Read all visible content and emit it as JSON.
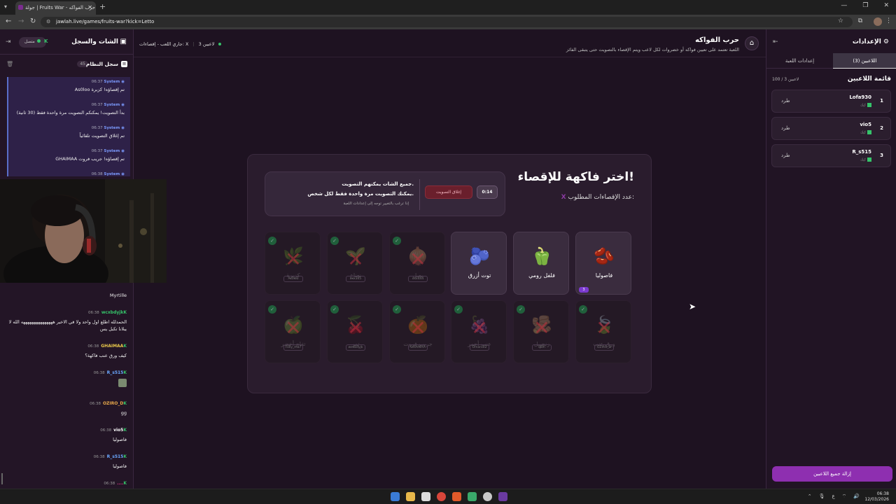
{
  "browser": {
    "tab_title": "جولة | Fruits War - حرب الفواكه",
    "url": "jawlah.live/games/fruits-war?kick=Letto"
  },
  "chat": {
    "title": "الشات والسجل",
    "status": "متصل",
    "syslog_label": "سجل النظام",
    "syslog_count": "45",
    "system_messages": [
      {
        "time": "06:37",
        "sender": "System",
        "text": "As0loo تم إقصاؤه! كزبرة"
      },
      {
        "time": "06:37",
        "sender": "System",
        "text": "بدأ التصويت! يمكنكم التصويت مرة واحدة فقط (30 ثانية)"
      },
      {
        "time": "06:37",
        "sender": "System",
        "text": "تم إغلاق التصويت تلقائياً"
      },
      {
        "time": "06:37",
        "sender": "System",
        "text": "GHAIMAA تم إقصاؤه! جريب فروت"
      },
      {
        "time": "06:38",
        "sender": "System",
        "text": ""
      }
    ],
    "messages": [
      {
        "user": "",
        "time": "",
        "color": "#ffffff",
        "text": "Myrtille",
        "emote": false
      },
      {
        "user": "wcxbdyjk",
        "time": "06:38",
        "color": "#35c46a",
        "text": "الحمدلله اطلع اول واحد ولا في الاخير هههههههههههههههه الله لا يبلانا تكبل يس",
        "emote": false
      },
      {
        "user": "GHAIMAA",
        "time": "06:38",
        "color": "#e8c84a",
        "text": "كيف ورق عنب فاكهة؟",
        "emote": false
      },
      {
        "user": "R_s515",
        "time": "06:38",
        "color": "#6aa8ff",
        "text": "",
        "emote": true
      },
      {
        "user": "OZIRO_D",
        "time": "06:38",
        "color": "#e8a84a",
        "text": "gg",
        "emote": false
      },
      {
        "user": "vio5",
        "time": "06:38",
        "color": "#ffffff",
        "text": "فاصوليا",
        "emote": false
      },
      {
        "user": "R_s515",
        "time": "06:38",
        "color": "#6aa8ff",
        "text": "فاصوليا",
        "emote": false
      },
      {
        "user": "....",
        "time": "06:38",
        "color": "#e03a8a",
        "text": "فاصوليا",
        "emote": false
      }
    ]
  },
  "header": {
    "title": "حرب الفواكه",
    "description": "اللعبة تعتمد على تعيين فواكه أو خضروات لكل لاعب ويتم الإقصاء بالتصويت حتى يتبقى الفائز",
    "players_badge": "3 لاعبين",
    "status": "جاري اللعب - إقصاءات: X"
  },
  "game": {
    "title": "اختر فاكهة للإقصاء!",
    "subtitle": "عدد الإقصاءات المطلوب:",
    "subtitle_x": "X",
    "vote_line1": "جميع الشات يمكنهم التصويت.",
    "vote_line2": "يمكنك التصويت مرة واحدة فقط لكل شخص.",
    "vote_line3": "إذا ترغب بالتغيير توجه إلى إعدادات اللعبة",
    "timer": "0:14",
    "close_vote": "إغلاق التصويت",
    "active_fruits": [
      {
        "name": "فاصوليا",
        "emoji": "🫘",
        "votes": "3"
      },
      {
        "name": "فلفل رومي",
        "emoji": "🫑",
        "votes": ""
      },
      {
        "name": "توت أزرق",
        "emoji": "🫐",
        "votes": ""
      }
    ],
    "eliminated_row1": [
      {
        "name": "كزبرة",
        "emoji": "🌿",
        "owner": "As0loo"
      },
      {
        "name": "نعناع",
        "emoji": "🌱",
        "owner": "xxx345"
      },
      {
        "name": "بصل",
        "emoji": "🧅",
        "owner": "xxx444"
      }
    ],
    "eliminated_row2": [
      {
        "name": "ورق عنب",
        "emoji": "🍃",
        "owner": "OZIRO_D"
      },
      {
        "name": "زنجبيل",
        "emoji": "🫚",
        "owner": "q8ih"
      },
      {
        "name": "عنب أحمر",
        "emoji": "🍇",
        "owner": "Omaro02"
      },
      {
        "name": "جريب فروت",
        "emoji": "🍊",
        "owner": "GHAIMAA"
      },
      {
        "name": "تمر",
        "emoji": "🍒",
        "owner": "wcxbdyjk"
      },
      {
        "name": "تفاح أخضر",
        "emoji": "🍏",
        "owner": "Folly_m17"
      }
    ]
  },
  "settings": {
    "title": "الإعدادات",
    "tab_players": "اللاعبين (3)",
    "tab_game": "إعدادات اللعبة",
    "players_title": "قائمة اللاعبين",
    "players_count": "100 / 3 لاعبين",
    "players": [
      {
        "num": "1",
        "name": "Lofa930",
        "role": "كيك",
        "kick": "طرد"
      },
      {
        "num": "2",
        "name": "vio5",
        "role": "كيك",
        "kick": "طرد"
      },
      {
        "num": "3",
        "name": "R_s515",
        "role": "كيك",
        "kick": "طرد"
      }
    ],
    "remove_all": "إزالة جميع اللاعبين"
  },
  "taskbar": {
    "time": "06:38",
    "date": "12/03/2026",
    "lang": "ع"
  },
  "colors": {
    "accent": "#8e2fb0",
    "kick_green": "#35c46a",
    "danger": "#6a1f2c"
  }
}
